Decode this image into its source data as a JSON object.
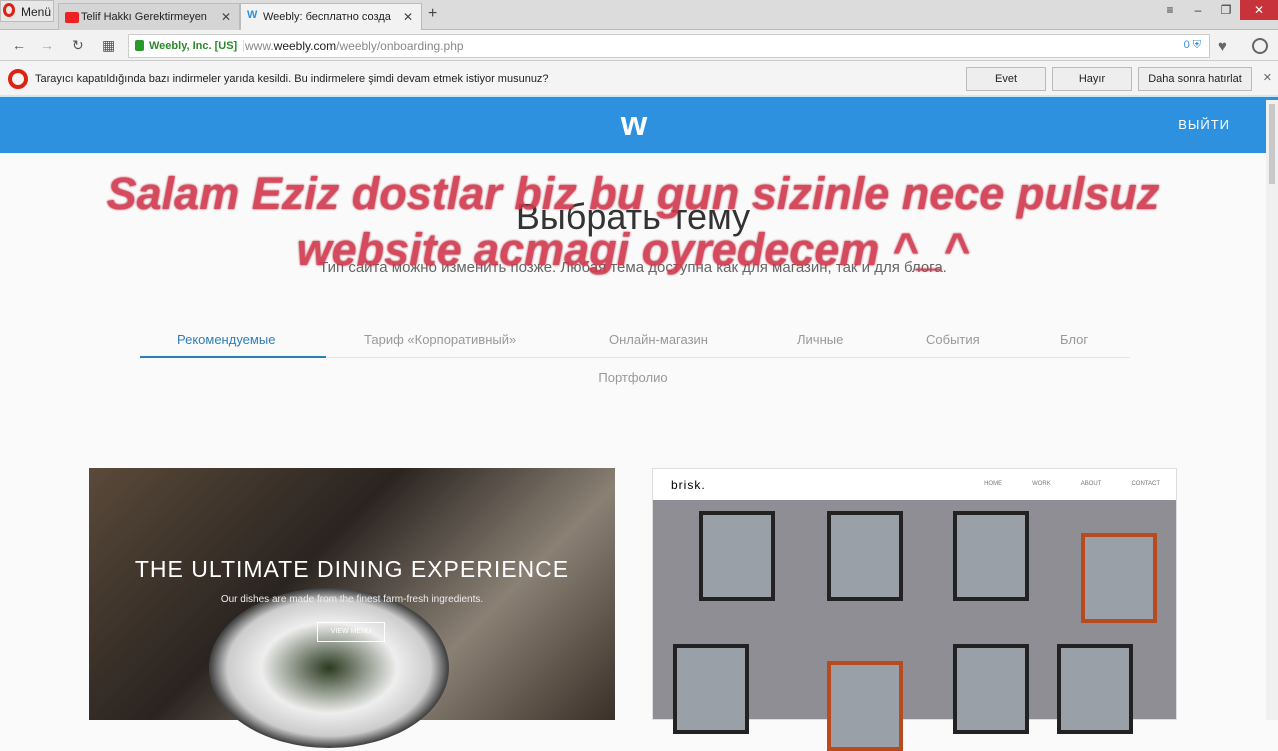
{
  "browser": {
    "menu": "Menü",
    "tabs": [
      {
        "title": "Telif Hakkı Gerektirmeyen"
      },
      {
        "title": "Weebly: бесплатно созда"
      }
    ],
    "cert": "Weebly, Inc. [US]",
    "url_pre": "www.",
    "url_domain": "weebly.com",
    "url_path": "/weebly/onboarding.php",
    "blocked_count": "0"
  },
  "notification": {
    "message": "Tarayıcı kapatıldığında bazı indirmeler yarıda kesildi. Bu indirmelere şimdi devam etmek istiyor musunuz?",
    "yes": "Evet",
    "no": "Hayır",
    "later": "Daha sonra hatırlat"
  },
  "header": {
    "logo": "w",
    "logout": "ВЫЙТИ"
  },
  "page": {
    "title": "Выбрать тему",
    "subtitle": "Тип сайта можно изменить позже. Любая тема доступна как для магазин, так и для блога.",
    "categories": [
      "Рекомендуемые",
      "Тариф «Корпоративный»",
      "Онлайн-магазин",
      "Личные",
      "События",
      "Блог"
    ],
    "portfolio": "Портфолио"
  },
  "overlay": {
    "line1": "Salam Eziz dostlar biz bu gun sizinle nece pulsuz",
    "line2": "website acmagi oyredecem ^_^"
  },
  "themes": [
    {
      "headline": "THE ULTIMATE DINING EXPERIENCE",
      "tagline": "Our dishes are made from the finest farm-fresh ingredients.",
      "button": "VIEW MENU"
    },
    {
      "brand": "brisk.",
      "nav": [
        "HOME",
        "WORK",
        "ABOUT",
        "CONTACT"
      ]
    }
  ]
}
